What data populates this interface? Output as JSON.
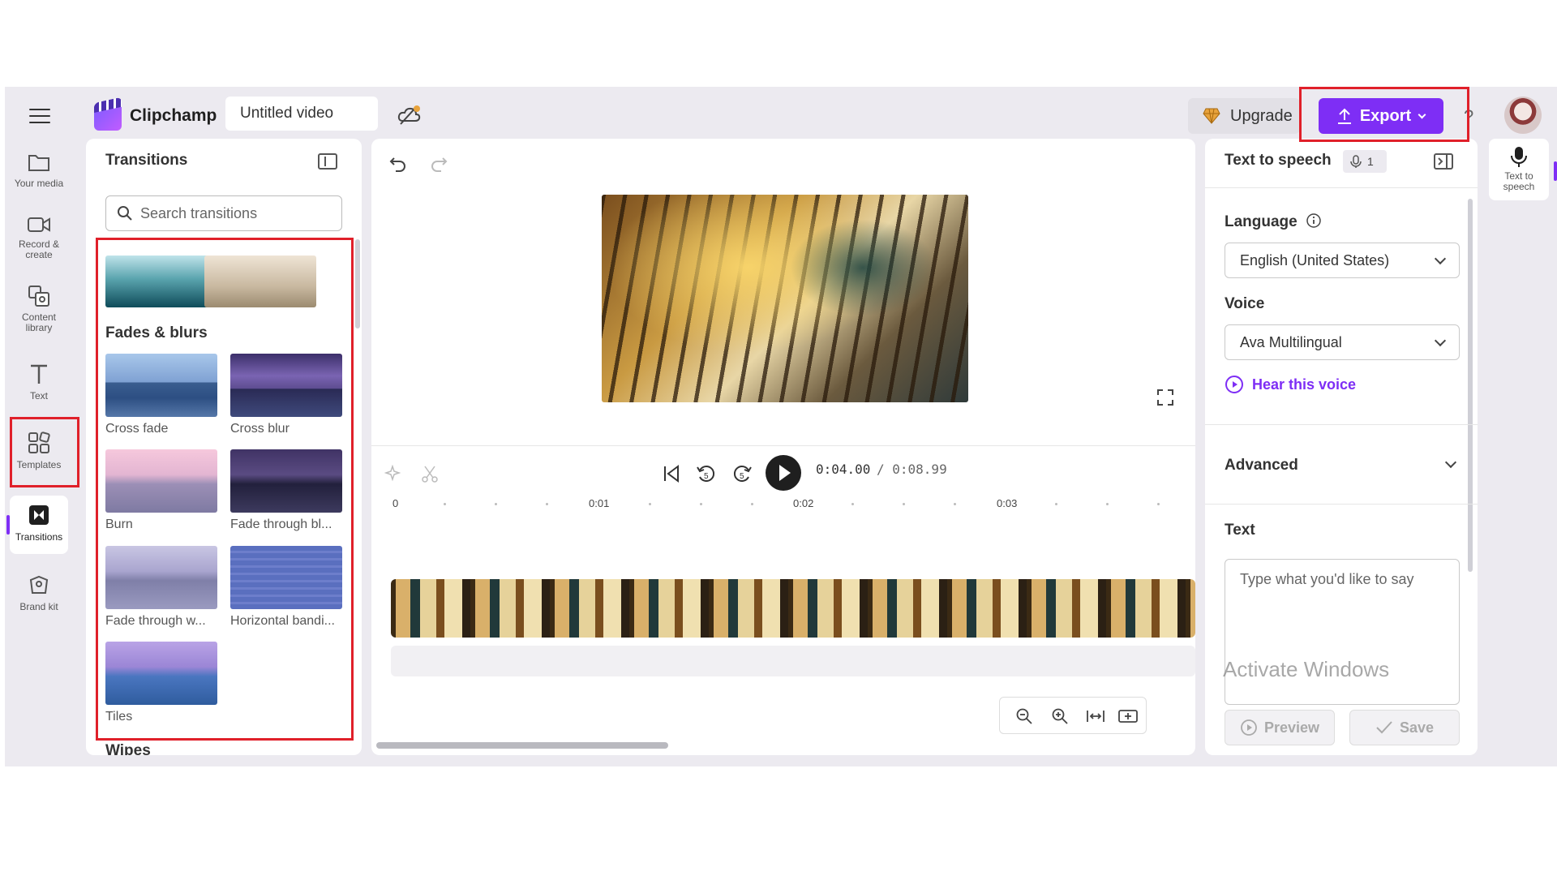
{
  "app": {
    "name": "Clipchamp",
    "project_title": "Untitled video"
  },
  "header": {
    "upgrade_label": "Upgrade",
    "export_label": "Export",
    "help_label": "?"
  },
  "rail": [
    {
      "id": "your-media",
      "label": "Your media",
      "icon": "folder-icon"
    },
    {
      "id": "record",
      "label": "Record &\ncreate",
      "icon": "camera-icon"
    },
    {
      "id": "content",
      "label": "Content\nlibrary",
      "icon": "library-icon"
    },
    {
      "id": "text",
      "label": "Text",
      "icon": "text-icon"
    },
    {
      "id": "templates",
      "label": "Templates",
      "icon": "templates-icon"
    },
    {
      "id": "transitions",
      "label": "Transitions",
      "icon": "transitions-icon",
      "active": true
    },
    {
      "id": "brand-kit",
      "label": "Brand kit",
      "icon": "brand-kit-icon"
    }
  ],
  "transitions_panel": {
    "title": "Transitions",
    "search_placeholder": "Search transitions",
    "section": "Fades & blurs",
    "items": [
      {
        "label": "Cross fade"
      },
      {
        "label": "Cross blur"
      },
      {
        "label": "Burn"
      },
      {
        "label": "Fade through bl..."
      },
      {
        "label": "Fade through w..."
      },
      {
        "label": "Horizontal bandi..."
      },
      {
        "label": "Tiles"
      }
    ],
    "next_section": "Wipes"
  },
  "player": {
    "current_time": "0:04.00",
    "total_time": "/ 0:08.99",
    "ruler": [
      "0",
      "0:01",
      "0:02",
      "0:03"
    ]
  },
  "tts_panel": {
    "title": "Text to speech",
    "badge_count": "1",
    "language_label": "Language",
    "language_value": "English (United States)",
    "voice_label": "Voice",
    "voice_value": "Ava Multilingual",
    "hear_voice": "Hear this voice",
    "advanced_label": "Advanced",
    "text_label": "Text",
    "text_placeholder": "Type what you'd like to say",
    "preview_label": "Preview",
    "save_label": "Save"
  },
  "right_rail": {
    "label": "Text to\nspeech"
  },
  "watermark": "Activate Windows",
  "colors": {
    "accent": "#7e2ef5",
    "highlight": "#e0202a"
  }
}
